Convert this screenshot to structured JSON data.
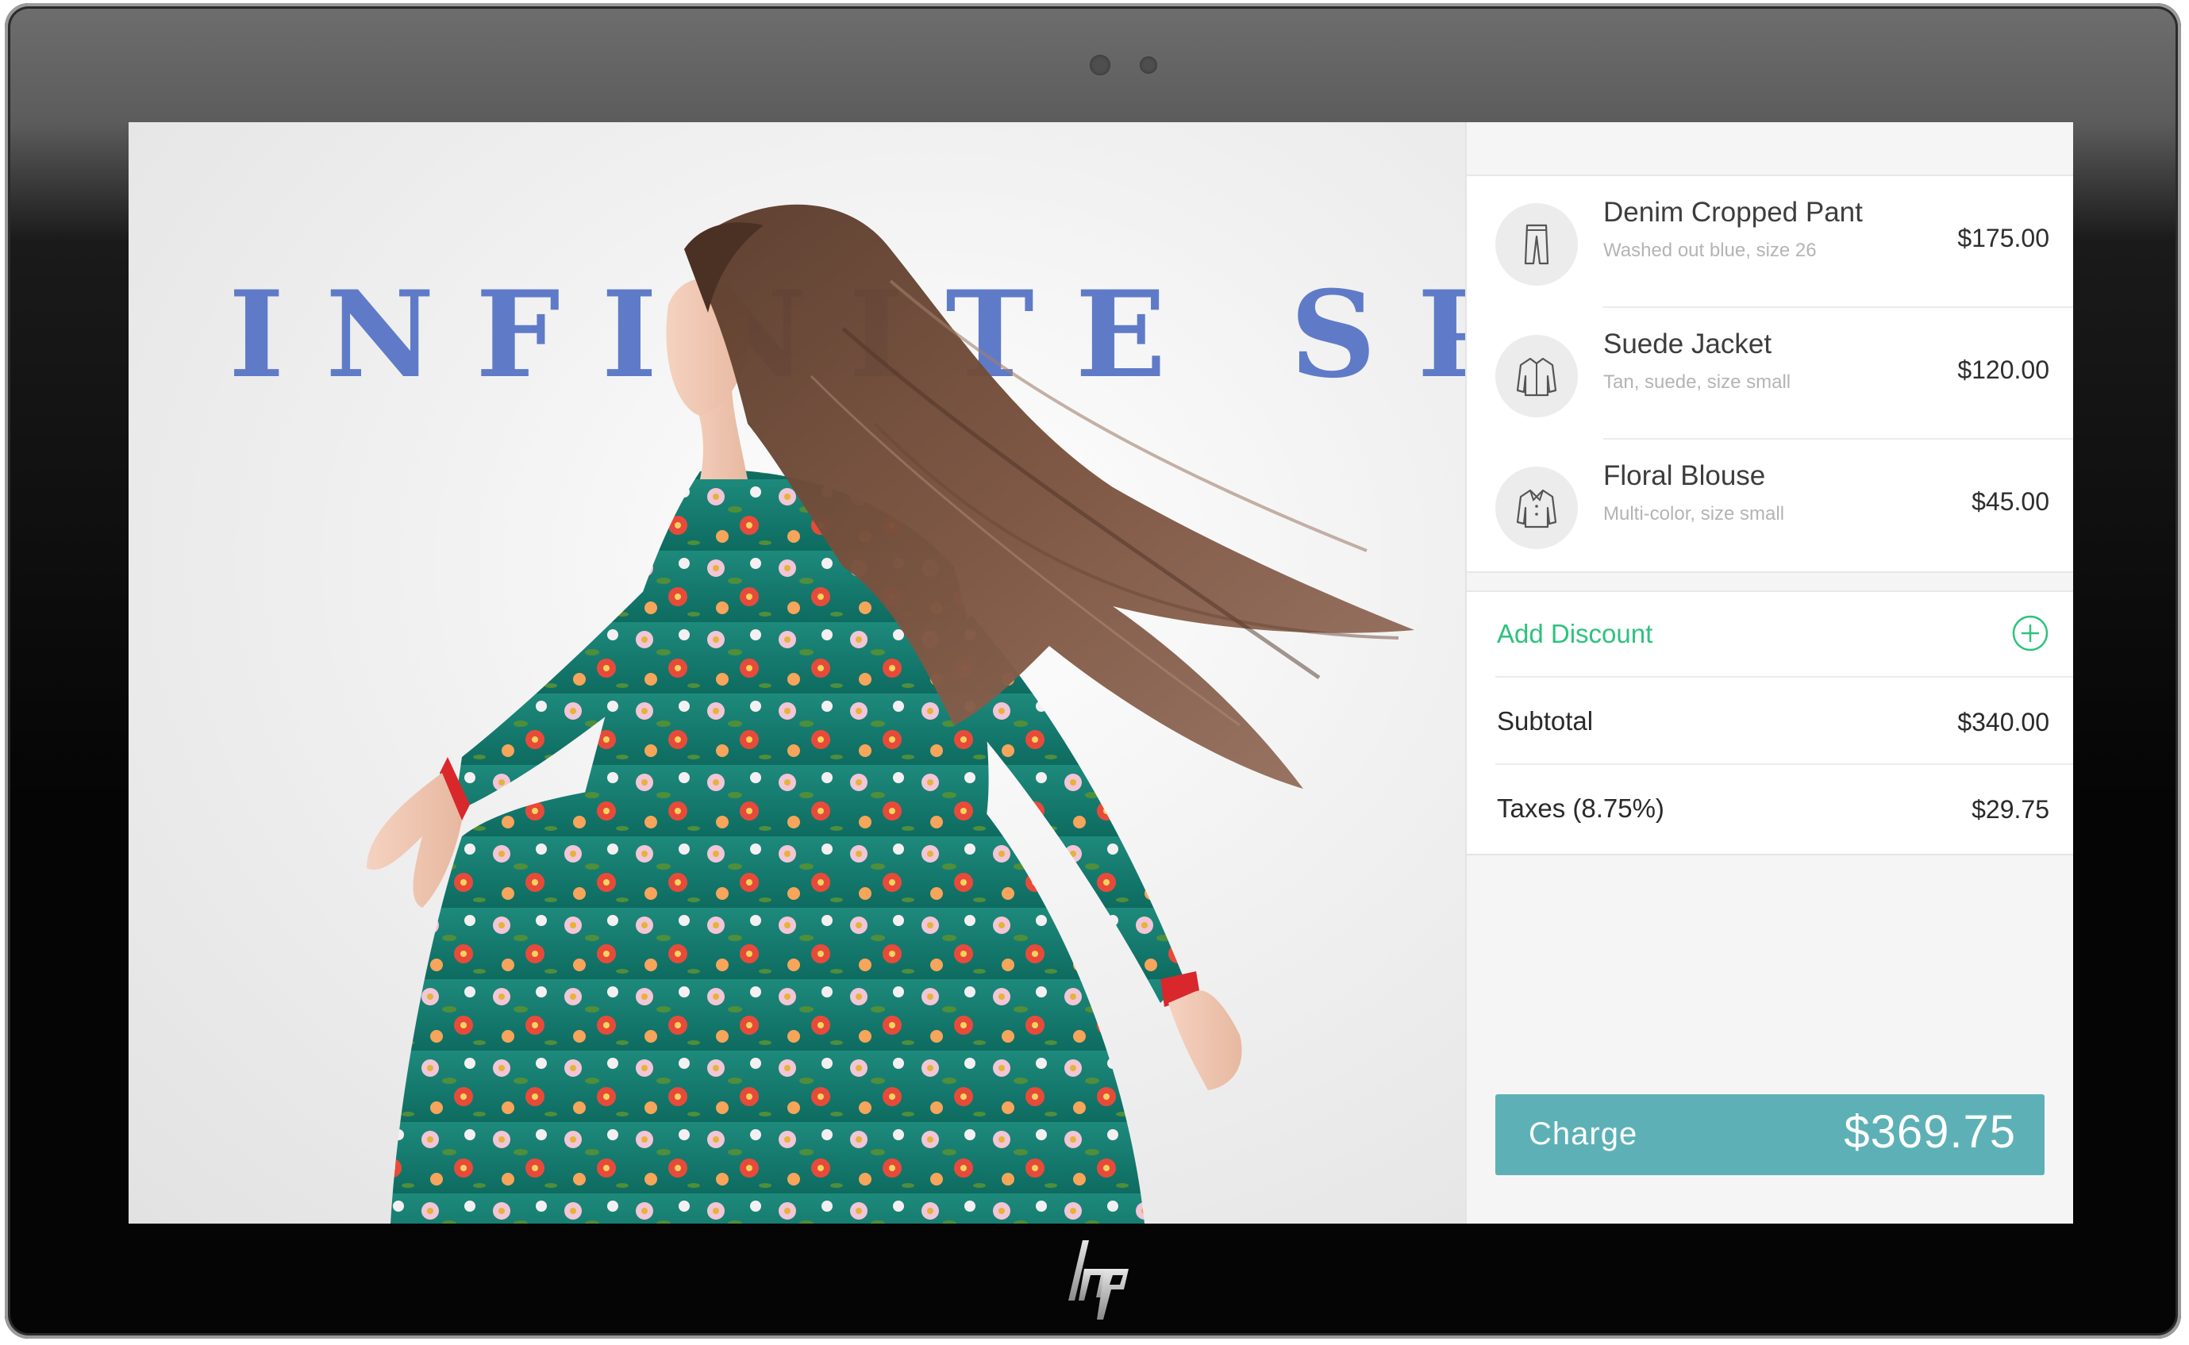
{
  "hero": {
    "title": "INFINITE SPIRIT"
  },
  "cart": {
    "items": [
      {
        "icon": "pants-icon",
        "name": "Denim Cropped Pant",
        "description": "Washed out blue, size 26",
        "price": "$175.00"
      },
      {
        "icon": "jacket-icon",
        "name": "Suede Jacket",
        "description": "Tan, suede, size small",
        "price": "$120.00"
      },
      {
        "icon": "blouse-icon",
        "name": "Floral Blouse",
        "description": "Multi-color, size small",
        "price": "$45.00"
      }
    ],
    "discount_label": "Add Discount",
    "subtotal_label": "Subtotal",
    "subtotal_value": "$340.00",
    "tax_label": "Taxes (8.75%)",
    "tax_value": "$29.75",
    "charge_label": "Charge",
    "charge_amount": "$369.75"
  },
  "colors": {
    "accent_green": "#2ec27e",
    "charge_button": "#5db1b6",
    "title_blue": "#5f7bc8"
  },
  "device": {
    "brand_logo": "hp-logo"
  }
}
